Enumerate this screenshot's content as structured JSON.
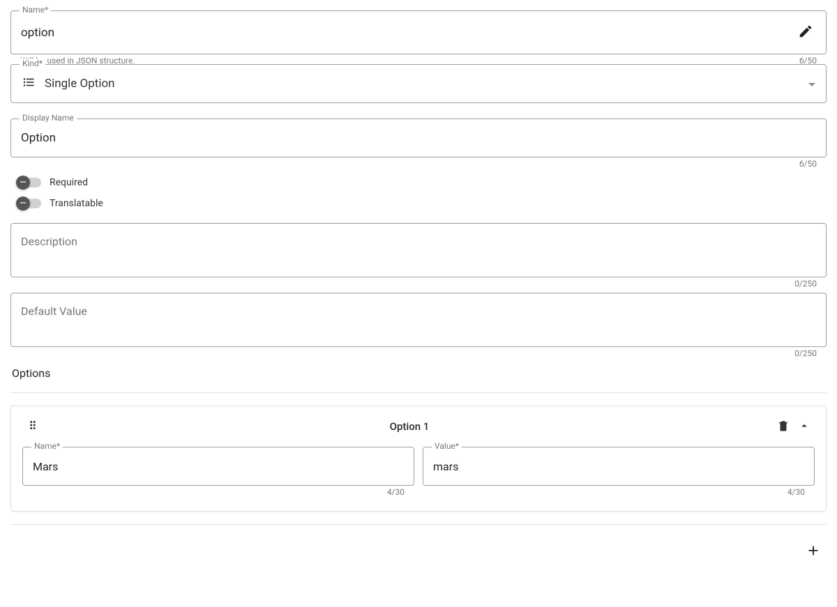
{
  "name_field": {
    "label": "Name*",
    "value": "option",
    "helper": "Will be used in JSON structure.",
    "counter": "6/50"
  },
  "kind_field": {
    "label": "Kind*",
    "value": "Single Option"
  },
  "display_name_field": {
    "label": "Display Name",
    "value": "Option",
    "counter": "6/50"
  },
  "toggles": {
    "required_label": "Required",
    "translatable_label": "Translatable"
  },
  "description_field": {
    "placeholder": "Description",
    "counter": "0/250"
  },
  "default_value_field": {
    "placeholder": "Default Value",
    "counter": "0/250"
  },
  "options_section": {
    "title": "Options",
    "items": [
      {
        "title": "Option 1",
        "name_label": "Name*",
        "name_value": "Mars",
        "name_counter": "4/30",
        "value_label": "Value*",
        "value_value": "mars",
        "value_counter": "4/30"
      }
    ]
  }
}
